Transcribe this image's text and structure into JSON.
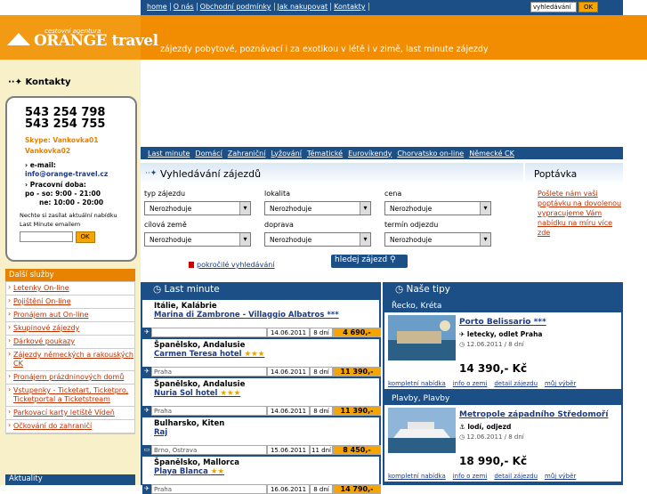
{
  "top_nav": [
    "home",
    "O nás",
    "Obchodní podmínky",
    "Jak nakupovat",
    "Kontakty"
  ],
  "top_search": {
    "value": "vyhledávání",
    "button": "OK"
  },
  "brand": {
    "agency": "cestovní agentura",
    "name": "ORANGE travel"
  },
  "tagline": "zájezdy pobytové, poznávací i za exotikou v létě i v zimě, last minute zájezdy",
  "contacts": {
    "title": "Kontakty",
    "phone1": "543 254 798",
    "phone2": "543 254 755",
    "skype1": "Skype: Vankovka01",
    "skype2": "Vankovka02",
    "email_label": "e-mail:",
    "email": "info@orange-travel.cz",
    "hours_label": "Pracovní doba:",
    "hours1": "po - so:   9:00 - 21:00",
    "hours2": "ne: 10:00 - 20:00",
    "newsletter1": "Nechte si zasílat aktuální nabídku",
    "newsletter2": "Last Minute emailem",
    "newsletter_button": "OK"
  },
  "services": {
    "title": "Další služby",
    "items": [
      "Letenky On-line",
      "Pojištění On-line",
      "Pronájem aut On-line",
      "Skupinové zájezdy",
      "Dárkové poukazy",
      "Zájezdy německých a rakouských CK",
      "Pronájem prázdninových domů",
      "Vstupenky - Ticketart, Ticketpro, Ticketportal a Ticketstream",
      "Parkovací karty letiště Vídeň",
      "Očkování do zahraničí"
    ]
  },
  "aktuality": "Aktuality",
  "categories": [
    "Last minute",
    "Domácí",
    "Zahraniční",
    "Lyžování",
    "Tématické",
    "Eurovíkendy",
    "Chorvatsko on-line",
    "Německé CK"
  ],
  "search": {
    "title": "Vyhledávání zájezdů",
    "fields": [
      {
        "label": "typ zájezdu",
        "value": "Nerozhoduje"
      },
      {
        "label": "lokalita",
        "value": "Nerozhoduje"
      },
      {
        "label": "cena",
        "value": "Nerozhoduje"
      },
      {
        "label": "cílová země",
        "value": "Nerozhoduje"
      },
      {
        "label": "doprava",
        "value": "Nerozhoduje"
      },
      {
        "label": "termín odjezdu",
        "value": "Nerozhoduje"
      }
    ],
    "advanced": "pokročilé vyhledávání",
    "button": "hledej zájezd"
  },
  "poptavka": {
    "title": "Poptávka",
    "text": "Pošlete nám vaši poptávku na dovolenou vypracujeme Vám nabídku na míru více zde"
  },
  "last_minute": {
    "title": "Last minute",
    "items": [
      {
        "country": "Itálie, Kalábrie",
        "name": "Marina di Zambrone - Villaggio Albatros ***",
        "from": "",
        "date": "14.06.2011",
        "days": "8 dní",
        "price": "4 690,-"
      },
      {
        "country": "Španělsko, Andalusie",
        "name": "Carmen Teresa hotel",
        "stars": "★★★",
        "from": "Praha",
        "date": "14.06.2011",
        "days": "8 dní",
        "price": "11 390,-"
      },
      {
        "country": "Španělsko, Andalusie",
        "name": "Nuria Sol hotel",
        "stars": "★★★",
        "from": "Praha",
        "date": "14.06.2011",
        "days": "8 dní",
        "price": "11 390,-"
      },
      {
        "country": "Bulharsko, Kiten",
        "name": "Raj",
        "from": "Brno, Ostrava",
        "date": "15.06.2011",
        "days": "11 dní",
        "price": "8 450,-"
      },
      {
        "country": "Španělsko, Mallorca",
        "name": "Playa Blanca",
        "stars": "★★",
        "from": "Praha",
        "date": "16.06.2011",
        "days": "8 dní",
        "price": "14 790,-"
      }
    ]
  },
  "tips": {
    "title": "Naše tipy",
    "items": [
      {
        "region": "Řecko, Kréta",
        "name": "Porto Belissario ***",
        "mode": "letecky, odlet Praha",
        "date": "12.06.2011 / 8 dní",
        "price": "14 390,- Kč"
      },
      {
        "region": "Plavby, Plavby",
        "name": "Metropole západního Středomoří",
        "mode": "lodí, odjezd",
        "date": "12.06.2011 / 8 dní",
        "price": "18 990,- Kč"
      }
    ],
    "links": [
      "kompletní nabídka",
      "info o zemi",
      "detail zájezdu",
      "můj výběr"
    ]
  },
  "colors": {
    "orange": "#f28c00",
    "blue": "#1b4f86"
  }
}
